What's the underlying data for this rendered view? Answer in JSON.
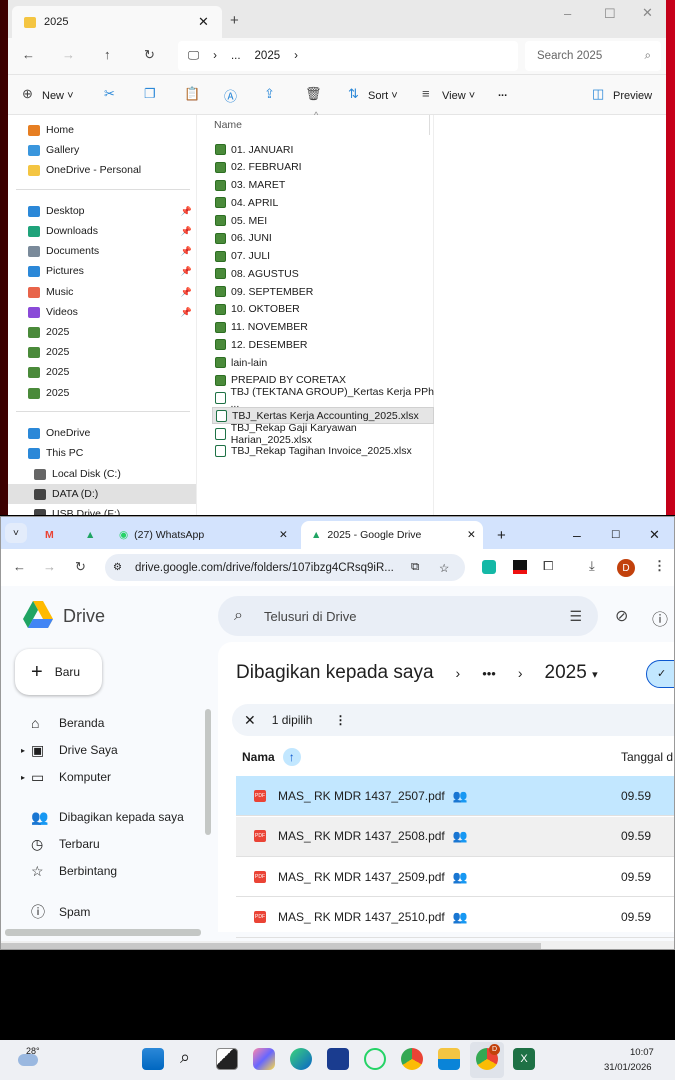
{
  "explorer": {
    "tab_title": "2025",
    "breadcrumb": [
      "...",
      "2025"
    ],
    "search_placeholder": "Search 2025",
    "toolbar": {
      "new": "New",
      "sort": "Sort",
      "view": "View",
      "more": "...",
      "preview": "Preview"
    },
    "column_name": "Name",
    "sidebar": [
      {
        "label": "Home",
        "icon": "home-icon",
        "color": "#e67e22"
      },
      {
        "label": "Gallery",
        "icon": "gallery-icon",
        "color": "#3a96dd"
      },
      {
        "label": "OneDrive - Personal",
        "icon": "folder-icon",
        "color": "#f4c542"
      },
      {
        "label": "Desktop",
        "icon": "desktop-icon",
        "color": "#2b88d8",
        "pinned": true
      },
      {
        "label": "Downloads",
        "icon": "download-icon",
        "color": "#1fa37a",
        "pinned": true
      },
      {
        "label": "Documents",
        "icon": "documents-icon",
        "color": "#7a8a9a",
        "pinned": true
      },
      {
        "label": "Pictures",
        "icon": "pictures-icon",
        "color": "#2b88d8",
        "pinned": true
      },
      {
        "label": "Music",
        "icon": "music-icon",
        "color": "#e8644a",
        "pinned": true
      },
      {
        "label": "Videos",
        "icon": "videos-icon",
        "color": "#8a4ad8",
        "pinned": true
      },
      {
        "label": "2025",
        "icon": "folder-icon",
        "color": "#4a8a3a"
      },
      {
        "label": "2025",
        "icon": "folder-icon",
        "color": "#4a8a3a"
      },
      {
        "label": "2025",
        "icon": "folder-icon",
        "color": "#4a8a3a"
      },
      {
        "label": "2025",
        "icon": "folder-icon",
        "color": "#4a8a3a"
      },
      {
        "label": "OneDrive",
        "icon": "cloud-icon",
        "color": "#2b88d8"
      },
      {
        "label": "This PC",
        "icon": "computer-icon",
        "color": "#2b88d8"
      },
      {
        "label": "Local Disk (C:)",
        "icon": "drive-icon",
        "color": "#666"
      },
      {
        "label": "DATA (D:)",
        "icon": "drive-icon",
        "color": "#444",
        "selected": true
      },
      {
        "label": "USB Drive (F:)",
        "icon": "usb-drive-icon",
        "color": "#444"
      }
    ],
    "files": [
      {
        "name": "01. JANUARI",
        "type": "folder"
      },
      {
        "name": "02. FEBRUARI",
        "type": "folder"
      },
      {
        "name": "03. MARET",
        "type": "folder"
      },
      {
        "name": "04. APRIL",
        "type": "folder"
      },
      {
        "name": "05. MEI",
        "type": "folder"
      },
      {
        "name": "06. JUNI",
        "type": "folder"
      },
      {
        "name": "07. JULI",
        "type": "folder"
      },
      {
        "name": "08. AGUSTUS",
        "type": "folder"
      },
      {
        "name": "09. SEPTEMBER",
        "type": "folder"
      },
      {
        "name": "10. OKTOBER",
        "type": "folder"
      },
      {
        "name": "11. NOVEMBER",
        "type": "folder"
      },
      {
        "name": "12. DESEMBER",
        "type": "folder"
      },
      {
        "name": "lain-lain",
        "type": "folder"
      },
      {
        "name": "PREPAID BY CORETAX",
        "type": "folder"
      },
      {
        "name": "TBJ (TEKTANA GROUP)_Kertas Kerja PPh ...",
        "type": "xlsx"
      },
      {
        "name": "TBJ_Kertas Kerja Accounting_2025.xlsx",
        "type": "xlsx",
        "selected": true
      },
      {
        "name": "TBJ_Rekap Gaji Karyawan Harian_2025.xlsx",
        "type": "xlsx"
      },
      {
        "name": "TBJ_Rekap Tagihan Invoice_2025.xlsx",
        "type": "xlsx"
      }
    ]
  },
  "chrome": {
    "tabs": [
      {
        "label": "(27) WhatsApp"
      },
      {
        "label": "2025 - Google Drive",
        "active": true
      }
    ],
    "url": "drive.google.com/drive/folders/107ibzg4CRsq9iR...",
    "profile_initial": "D",
    "drive": {
      "logo_text": "Drive",
      "search_placeholder": "Telusuri di Drive",
      "new_button": "Baru",
      "nav": [
        {
          "label": "Beranda",
          "icon": "home-icon"
        },
        {
          "label": "Drive Saya",
          "icon": "my-drive-icon",
          "expandable": true
        },
        {
          "label": "Komputer",
          "icon": "computer-icon",
          "expandable": true
        },
        {
          "label": "Dibagikan kepada saya",
          "icon": "shared-icon"
        },
        {
          "label": "Terbaru",
          "icon": "clock-icon"
        },
        {
          "label": "Berbintang",
          "icon": "star-icon"
        },
        {
          "label": "Spam",
          "icon": "spam-icon"
        }
      ],
      "breadcrumb_parent": "Dibagikan kepada saya",
      "breadcrumb_more": "•••",
      "breadcrumb_current": "2025",
      "selection_text": "1 dipilih",
      "col_name": "Nama",
      "col_date": "Tanggal d",
      "files": [
        {
          "name": "MAS_ RK MDR 1437_2507.pdf",
          "time": "09.59",
          "selected": true
        },
        {
          "name": "MAS_ RK MDR 1437_2508.pdf",
          "time": "09.59"
        },
        {
          "name": "MAS_ RK MDR 1437_2509.pdf",
          "time": "09.59"
        },
        {
          "name": "MAS_ RK MDR 1437_2510.pdf",
          "time": "09.59"
        }
      ]
    }
  },
  "taskbar": {
    "weather": "28°",
    "time": "10:07",
    "date": "31/01/2026",
    "chrome_badge": "D"
  }
}
